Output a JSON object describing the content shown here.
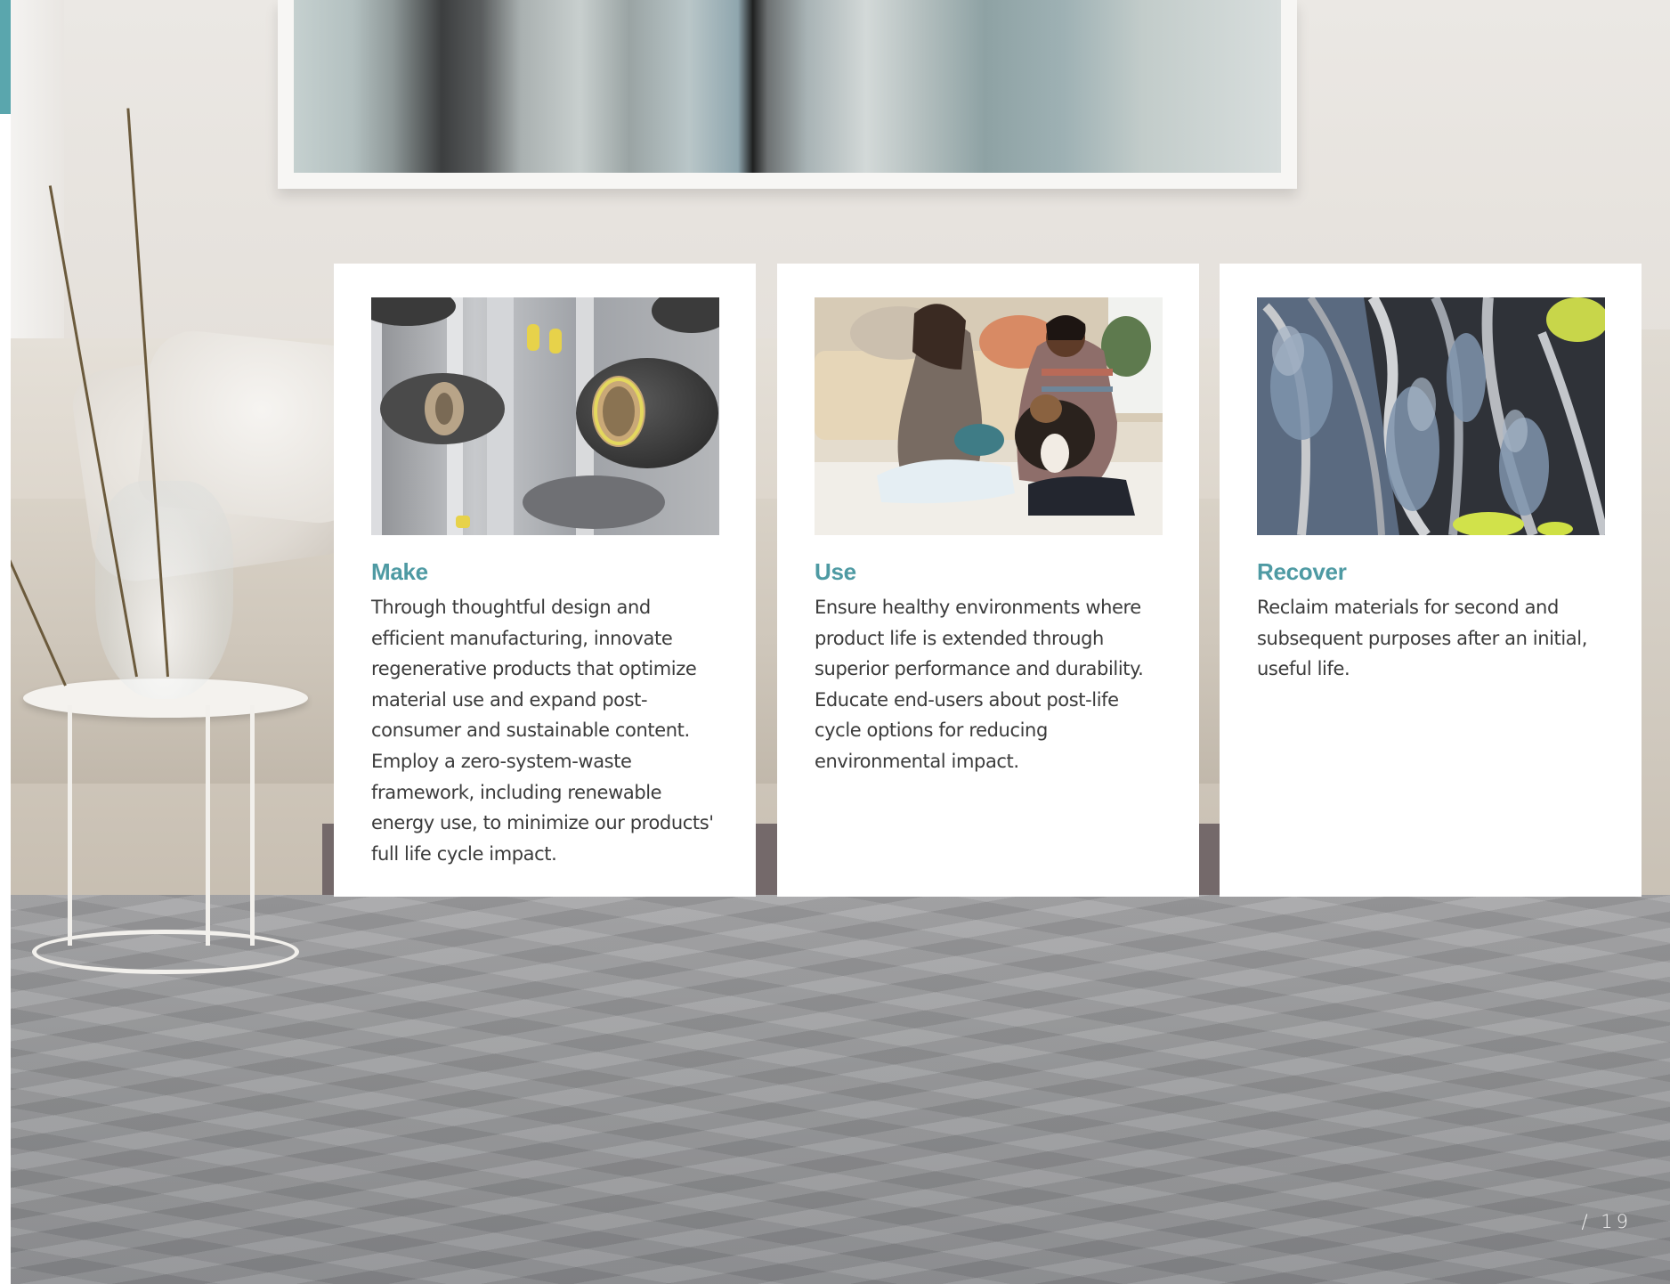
{
  "cards": [
    {
      "title": "Make",
      "body": "Through thoughtful design and efficient manufacturing, innovate regenerative products that optimize material use and expand post-consumer and sustainable content. Employ a zero-system-waste framework, including renewable energy use, to minimize our products' full life cycle impact."
    },
    {
      "title": "Use",
      "body": "Ensure healthy environments where product life is extended through superior performance and durability. Educate end-users about post-life cycle options for reducing environmental impact."
    },
    {
      "title": "Recover",
      "body": "Reclaim materials for second and subsequent purposes after an initial, useful life."
    }
  ],
  "page_number": "/ 19",
  "colors": {
    "accent": "#4e9aa3",
    "page_tab": "#5aa6ad",
    "body_text": "#3b3b3b"
  }
}
